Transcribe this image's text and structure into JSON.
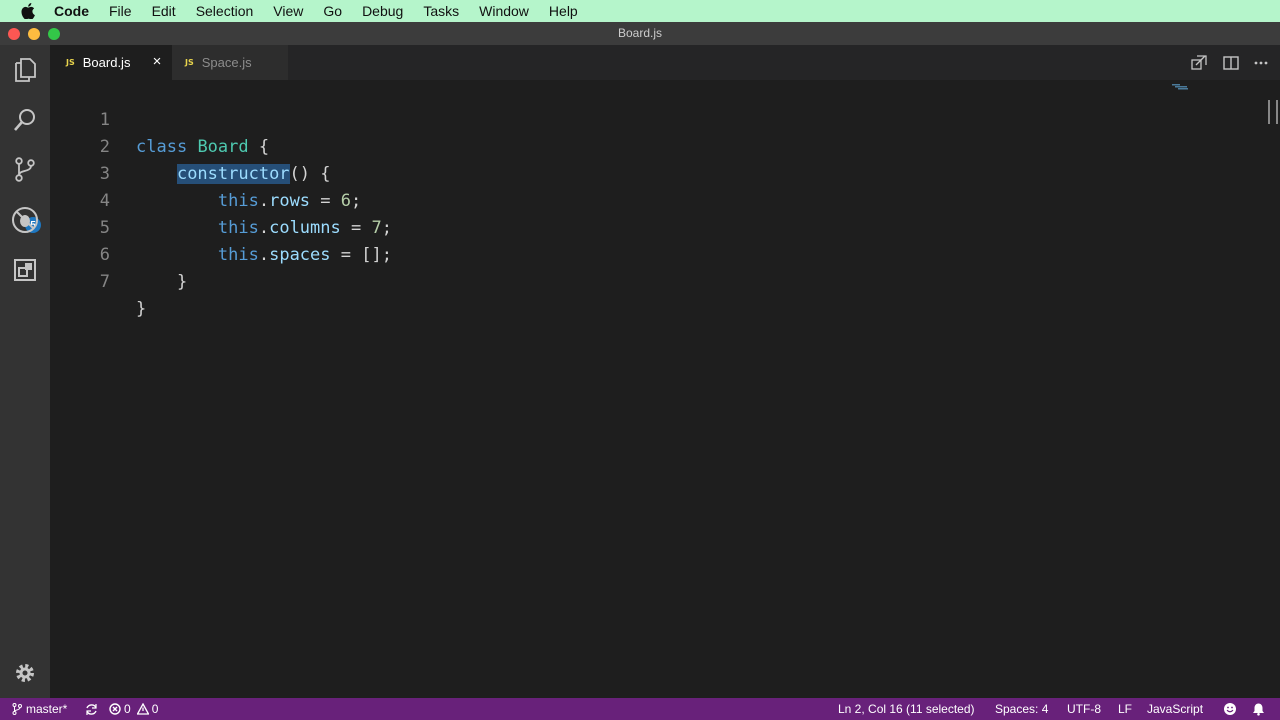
{
  "menubar": {
    "app": "Code",
    "items": [
      "File",
      "Edit",
      "Selection",
      "View",
      "Go",
      "Debug",
      "Tasks",
      "Window",
      "Help"
    ]
  },
  "window": {
    "title": "Board.js"
  },
  "activitybar": {
    "icons": [
      "files-icon",
      "search-icon",
      "source-control-icon",
      "debug-icon",
      "extensions-icon",
      "gear-icon"
    ],
    "scm_badge": "5"
  },
  "tabs": [
    {
      "icon": "JS",
      "label": "Board.js",
      "active": true
    },
    {
      "icon": "JS",
      "label": "Space.js",
      "active": false
    }
  ],
  "editor": {
    "line_numbers": [
      "1",
      "2",
      "3",
      "4",
      "5",
      "6",
      "7"
    ],
    "lines": [
      "class Board {",
      "    constructor() {",
      "        this.rows = 6;",
      "        this.columns = 7;",
      "        this.spaces = [];",
      "    }",
      "}"
    ],
    "selected_text": "constructor"
  },
  "statusbar": {
    "branch": "master*",
    "errors": "0",
    "warnings": "0",
    "position": "Ln 2, Col 16 (11 selected)",
    "indent": "Spaces: 4",
    "encoding": "UTF-8",
    "eol": "LF",
    "language": "JavaScript"
  },
  "colors": {
    "menubar": "#b5f5cb",
    "statusbar": "#68217a",
    "editor_bg": "#1e1e1e",
    "keyword": "#569cd6",
    "class_name": "#4ec9b0",
    "property": "#9cdcfe",
    "number": "#b5cea8",
    "selection": "#264f78"
  }
}
